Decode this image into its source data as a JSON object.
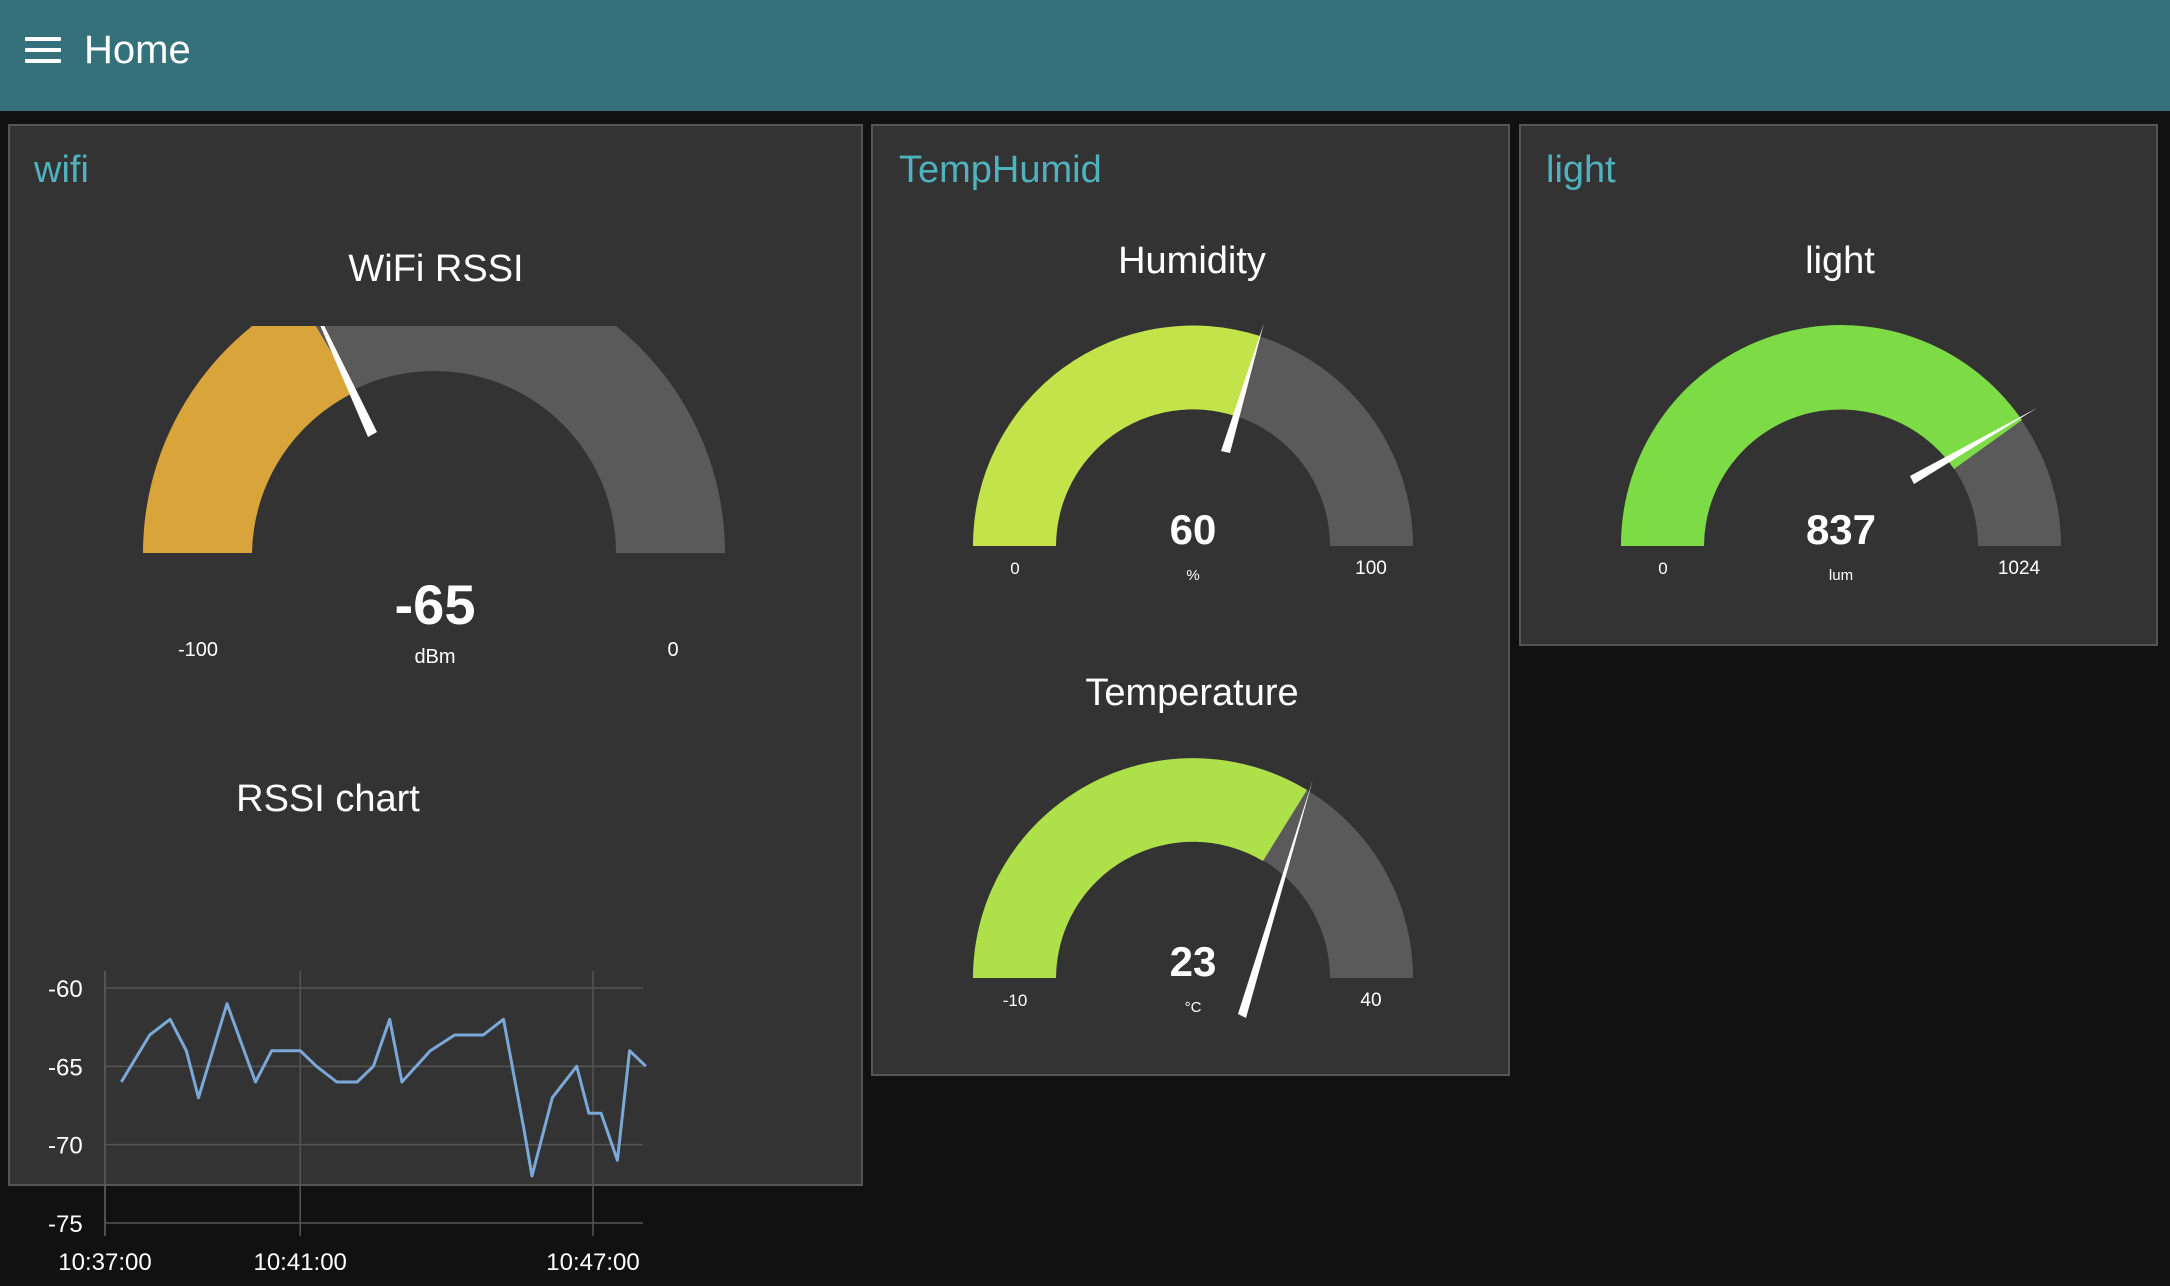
{
  "header": {
    "title": "Home",
    "menu_icon": "hamburger-menu-icon",
    "background": "#35717b"
  },
  "groups": {
    "wifi": {
      "title": "wifi"
    },
    "temphumid": {
      "title": "TempHumid"
    },
    "light": {
      "title": "light"
    }
  },
  "gauges": {
    "rssi": {
      "title": "WiFi RSSI",
      "value": "-65",
      "units": "dBm",
      "min": "-100",
      "max": "0",
      "fill_color": "#d9a43a"
    },
    "humidity": {
      "title": "Humidity",
      "value": "60",
      "units": "%",
      "min": "0",
      "max": "100",
      "fill_color": "#c2e34a"
    },
    "temperature": {
      "title": "Temperature",
      "value": "23",
      "units": "°C",
      "min": "-10",
      "max": "40",
      "fill_color": "#aee04a"
    },
    "light": {
      "title": "light",
      "value": "837",
      "units": "lum",
      "min": "0",
      "max": "1024",
      "fill_color": "#7ddc46"
    }
  },
  "chart_data": {
    "type": "line",
    "title": "RSSI chart",
    "xlabel": "",
    "ylabel": "",
    "x_ticks": [
      "10:37:00",
      "10:41:00",
      "10:47:00"
    ],
    "y_ticks": [
      "-60",
      "-65",
      "-70",
      "-75"
    ],
    "ylim": [
      -75,
      -59
    ],
    "grid": true,
    "series": [
      {
        "color": "#7aa8d9",
        "points": [
          [
            "10:37:20",
            -66
          ],
          [
            "10:37:55",
            -63
          ],
          [
            "10:38:20",
            -62
          ],
          [
            "10:38:40",
            -64
          ],
          [
            "10:38:55",
            -67
          ],
          [
            "10:39:30",
            -61
          ],
          [
            "10:40:05",
            -66
          ],
          [
            "10:40:25",
            -64
          ],
          [
            "10:40:55",
            -64
          ],
          [
            "10:41:00",
            -64
          ],
          [
            "10:41:20",
            -65
          ],
          [
            "10:41:45",
            -66
          ],
          [
            "10:42:10",
            -66
          ],
          [
            "10:42:30",
            -65
          ],
          [
            "10:42:50",
            -62
          ],
          [
            "10:43:05",
            -66
          ],
          [
            "10:43:40",
            -64
          ],
          [
            "10:44:10",
            -63
          ],
          [
            "10:44:45",
            -63
          ],
          [
            "10:45:10",
            -62
          ],
          [
            "10:45:35",
            -69
          ],
          [
            "10:45:45",
            -72
          ],
          [
            "10:46:10",
            -67
          ],
          [
            "10:46:40",
            -65
          ],
          [
            "10:46:55",
            -68
          ],
          [
            "10:47:10",
            -68
          ],
          [
            "10:47:30",
            -71
          ],
          [
            "10:47:45",
            -64
          ],
          [
            "10:48:05",
            -65
          ]
        ]
      }
    ]
  }
}
